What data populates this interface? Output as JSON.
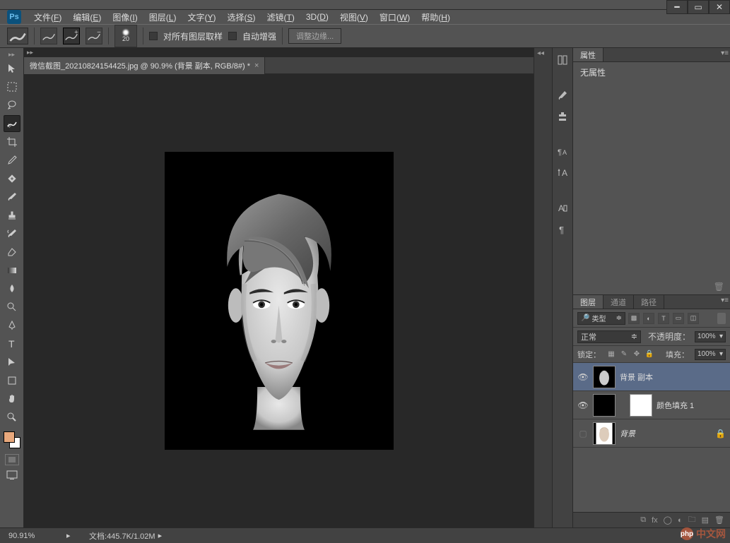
{
  "app": {
    "logo": "Ps"
  },
  "menu": {
    "items": [
      {
        "t": "文件",
        "u": "F"
      },
      {
        "t": "编辑",
        "u": "E"
      },
      {
        "t": "图像",
        "u": "I"
      },
      {
        "t": "图层",
        "u": "L"
      },
      {
        "t": "文字",
        "u": "Y"
      },
      {
        "t": "选择",
        "u": "S"
      },
      {
        "t": "滤镜",
        "u": "T"
      },
      {
        "t": "3D",
        "u": "D"
      },
      {
        "t": "视图",
        "u": "V"
      },
      {
        "t": "窗口",
        "u": "W"
      },
      {
        "t": "帮助",
        "u": "H"
      }
    ]
  },
  "options": {
    "brush_size": "20",
    "sample_all_layers": "对所有图层取样",
    "auto_enhance": "自动增强",
    "refine_edge": "调整边缘..."
  },
  "document": {
    "tab_title": "微信截图_20210824154425.jpg @ 90.9% (背景 副本, RGB/8#) *"
  },
  "properties": {
    "tab": "属性",
    "empty": "无属性"
  },
  "layers_panel": {
    "tabs": {
      "layers": "图层",
      "channels": "通道",
      "paths": "路径"
    },
    "filter_label": "类型",
    "blend_mode": "正常",
    "opacity_label": "不透明度：",
    "opacity_value": "100%",
    "lock_label": "锁定：",
    "fill_label": "填充：",
    "fill_value": "100%",
    "layers": [
      {
        "name": "背景 副本",
        "visible": true,
        "selected": true,
        "italic": false,
        "locked": false,
        "type": "image"
      },
      {
        "name": "颜色填充 1",
        "visible": true,
        "selected": false,
        "italic": false,
        "locked": false,
        "type": "fill"
      },
      {
        "name": "背景",
        "visible": false,
        "selected": false,
        "italic": true,
        "locked": true,
        "type": "image"
      }
    ]
  },
  "status": {
    "zoom": "90.91%",
    "doc_label": "文档:",
    "doc_size": "445.7K/1.02M"
  },
  "watermark": {
    "text": "中文网",
    "prefix": "php"
  }
}
